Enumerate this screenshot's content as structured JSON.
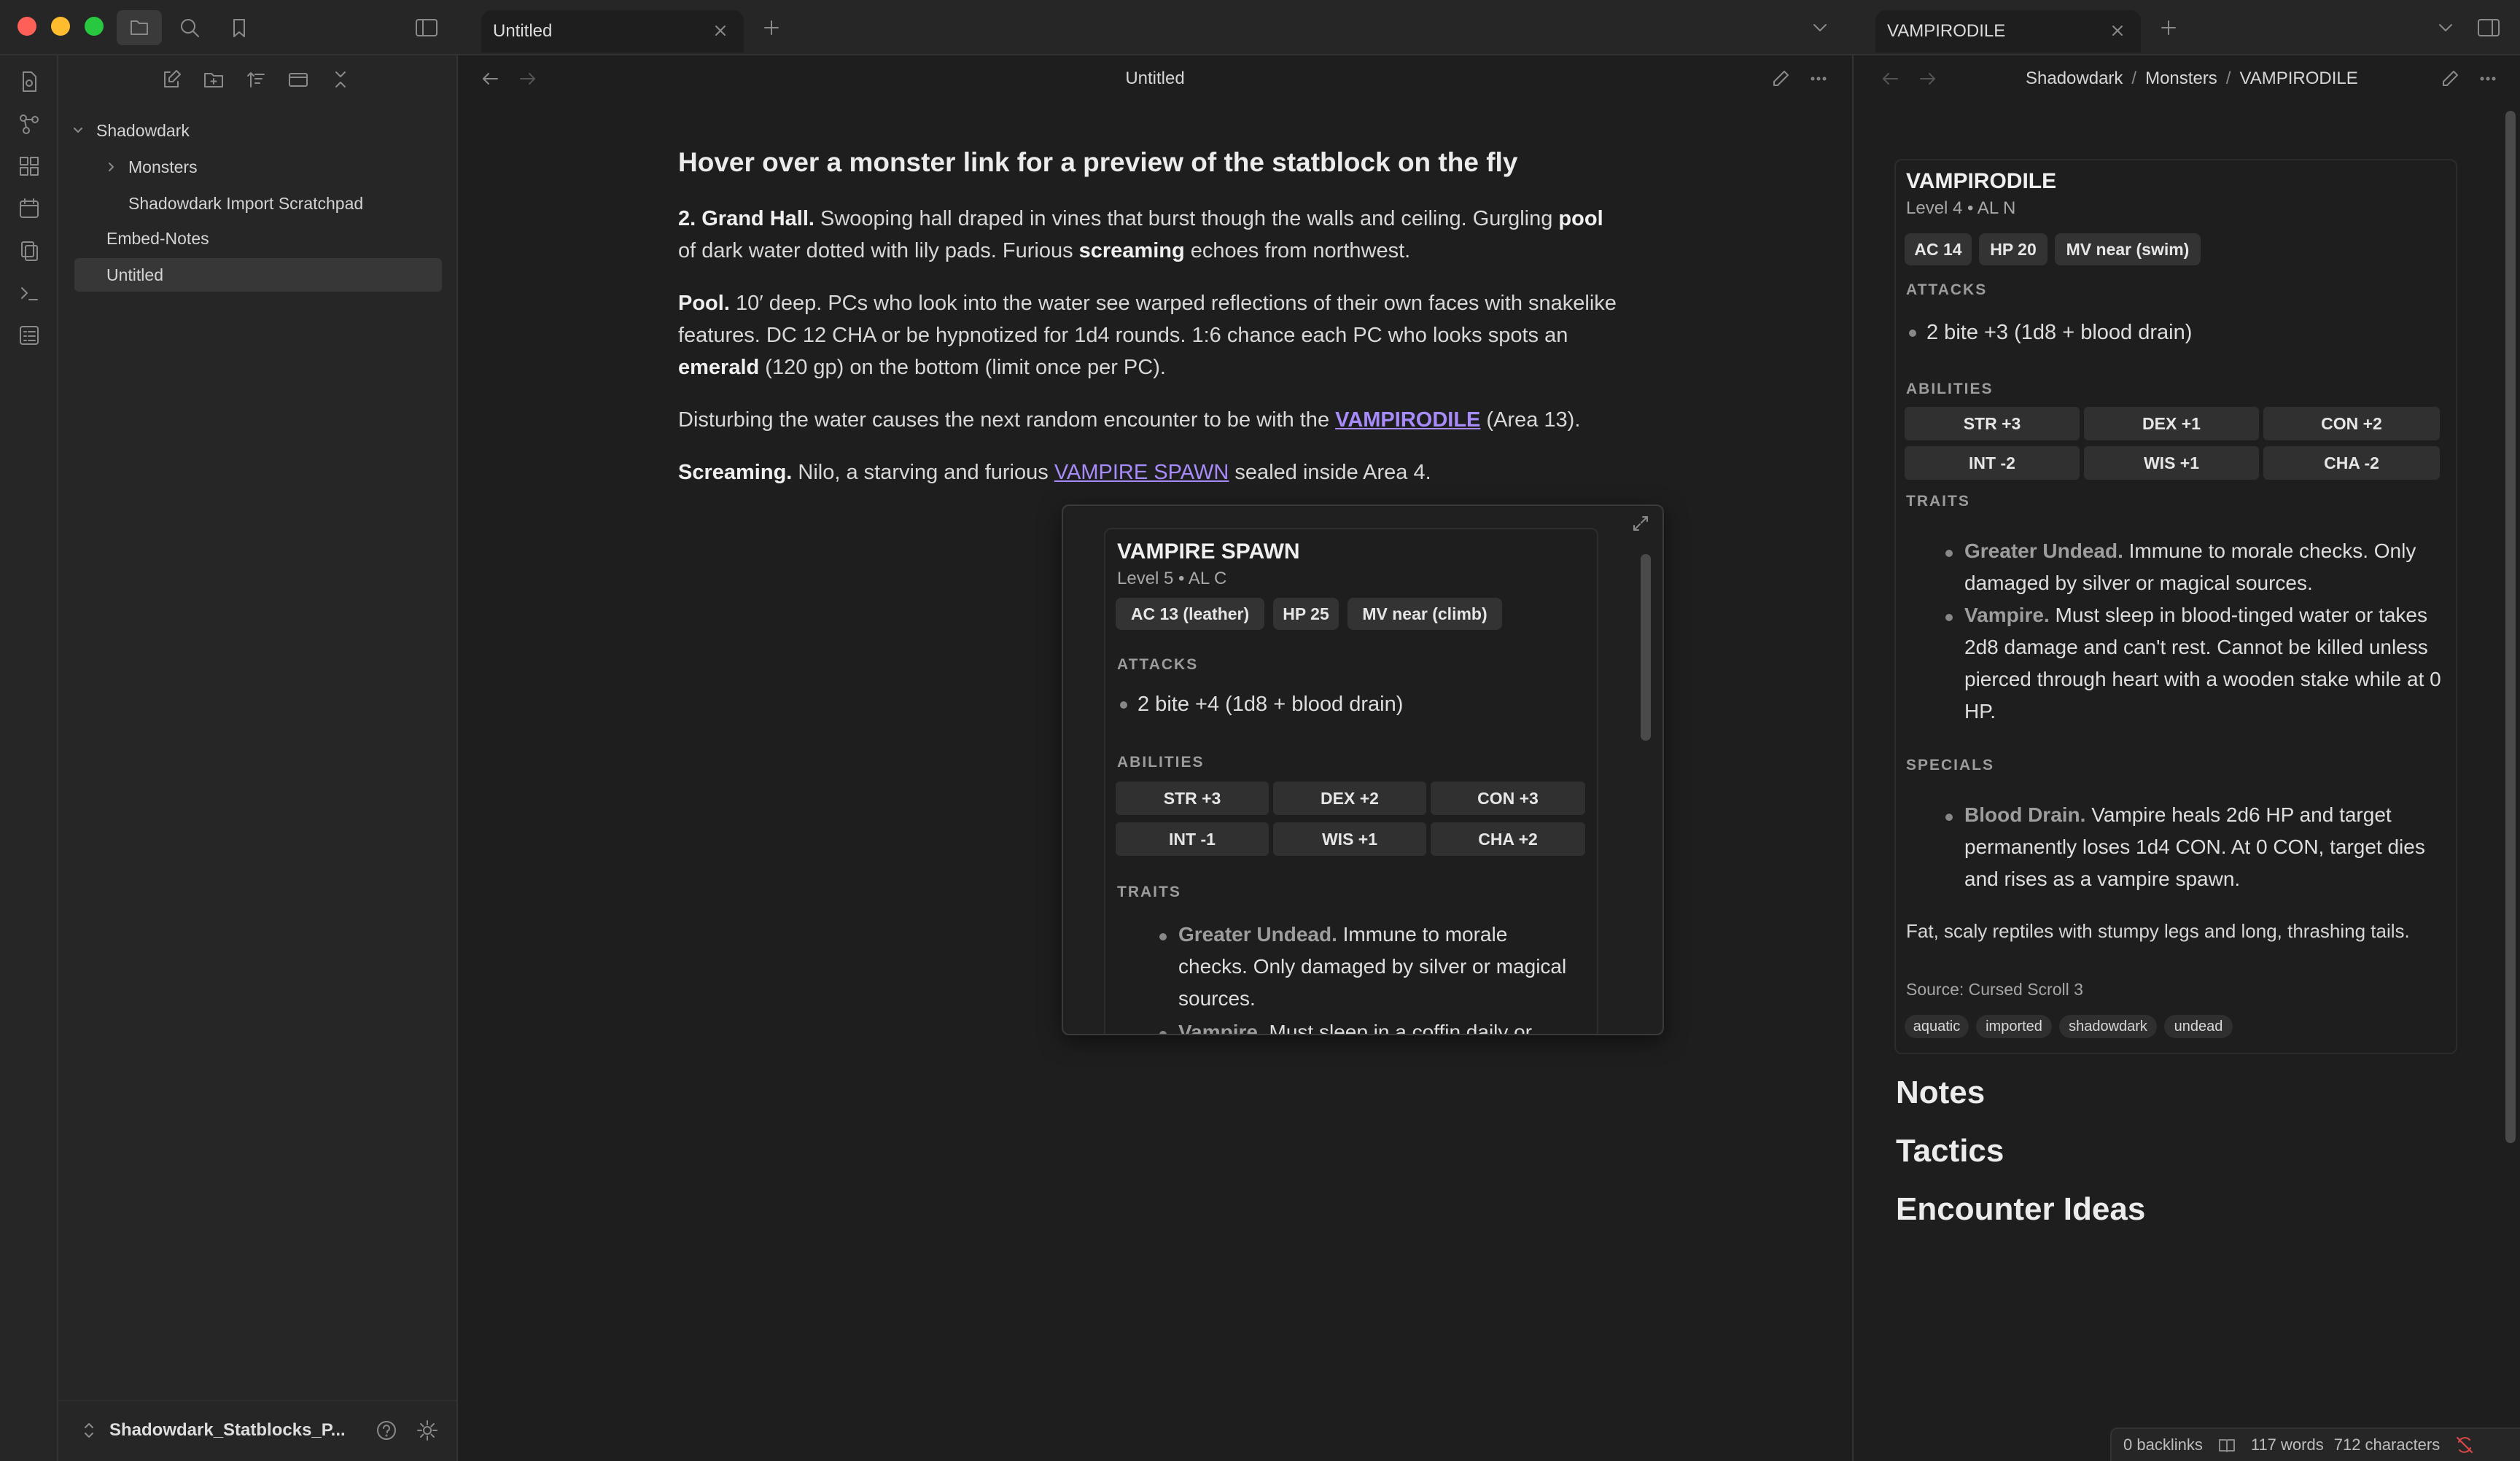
{
  "tabs": {
    "left": {
      "label": "Untitled"
    },
    "right": {
      "label": "VAMPIRODILE"
    }
  },
  "sidebar": {
    "tree": [
      {
        "label": "Shadowdark"
      },
      {
        "label": "Monsters"
      },
      {
        "label": "Shadowdark Import Scratchpad"
      },
      {
        "label": "Embed-Notes"
      },
      {
        "label": "Untitled"
      }
    ],
    "vault_name": "Shadowdark_Statblocks_P..."
  },
  "editor": {
    "title": "Untitled",
    "heading": "Hover over a monster link for a preview of the statblock on the fly",
    "p1": {
      "bold1": "2. Grand Hall.",
      "text1": " Swooping hall draped in vines that burst though the walls and ceiling. Gurgling ",
      "bold2": "pool",
      "text2": " of dark water dotted with lily pads. Furious ",
      "bold3": "screaming",
      "text3": " echoes from northwest."
    },
    "p2": {
      "bold1": "Pool.",
      "text1": " 10′ deep. PCs who look into the water see warped reflections of their own faces with snakelike features. DC 12 CHA or be hypnotized for 1d4 rounds. 1:6 chance each PC who looks spots an ",
      "bold2": "emerald",
      "text2": " (120 gp) on the bottom (limit once per PC)."
    },
    "p3": {
      "text1": "Disturbing the water causes the next random encounter to be with the ",
      "link": "VAMPIRODILE",
      "text2": " (Area 13)."
    },
    "p4": {
      "bold1": "Screaming.",
      "text1": " Nilo, a starving and furious ",
      "link": "VAMPIRE SPAWN",
      "text2": " sealed inside Area 4."
    }
  },
  "popover": {
    "name": "VAMPIRE SPAWN",
    "sub": "Level 5 • AL C",
    "pills": [
      "AC 13 (leather)",
      "HP 25",
      "MV near (climb)"
    ],
    "attacks_label": "ATTACKS",
    "attack": "2 bite +4 (1d8 + blood drain)",
    "abilities_label": "ABILITIES",
    "abilities": [
      "STR +3",
      "DEX +2",
      "CON +3",
      "INT -1",
      "WIS +1",
      "CHA +2"
    ],
    "traits_label": "TRAITS",
    "traits": [
      {
        "name": "Greater Undead.",
        "text": " Immune to morale checks. Only damaged by silver or magical sources."
      },
      {
        "name": "Vampire.",
        "text": " Must sleep in a coffin daily or"
      }
    ]
  },
  "right": {
    "breadcrumb": [
      "Shadowdark",
      "/",
      "Monsters",
      "/",
      "VAMPIRODILE"
    ],
    "name": "VAMPIRODILE",
    "sub": "Level 4 • AL N",
    "pills": [
      "AC 14",
      "HP 20",
      "MV near (swim)"
    ],
    "attacks_label": "ATTACKS",
    "attack": "2 bite +3 (1d8 + blood drain)",
    "abilities_label": "ABILITIES",
    "abilities": [
      "STR +3",
      "DEX +1",
      "CON +2",
      "INT -2",
      "WIS +1",
      "CHA -2"
    ],
    "traits_label": "TRAITS",
    "traits": [
      {
        "name": "Greater Undead.",
        "text": " Immune to morale checks. Only damaged by silver or magical sources."
      },
      {
        "name": "Vampire.",
        "text": " Must sleep in blood-tinged water or takes 2d8 damage and can't rest. Cannot be killed unless pierced through heart with a wooden stake while at 0 HP."
      }
    ],
    "specials_label": "SPECIALS",
    "specials": [
      {
        "name": "Blood Drain.",
        "text": " Vampire heals 2d6 HP and target permanently loses 1d4 CON. At 0 CON, target dies and rises as a vampire spawn."
      }
    ],
    "description": "Fat, scaly reptiles with stumpy legs and long, thrashing tails.",
    "source": "Source: Cursed Scroll 3",
    "tags": [
      "aquatic",
      "imported",
      "shadowdark",
      "undead"
    ],
    "headings": [
      "Notes",
      "Tactics",
      "Encounter Ideas"
    ]
  },
  "status": {
    "backlinks": "0 backlinks",
    "words": "117 words",
    "chars": "712 characters"
  }
}
